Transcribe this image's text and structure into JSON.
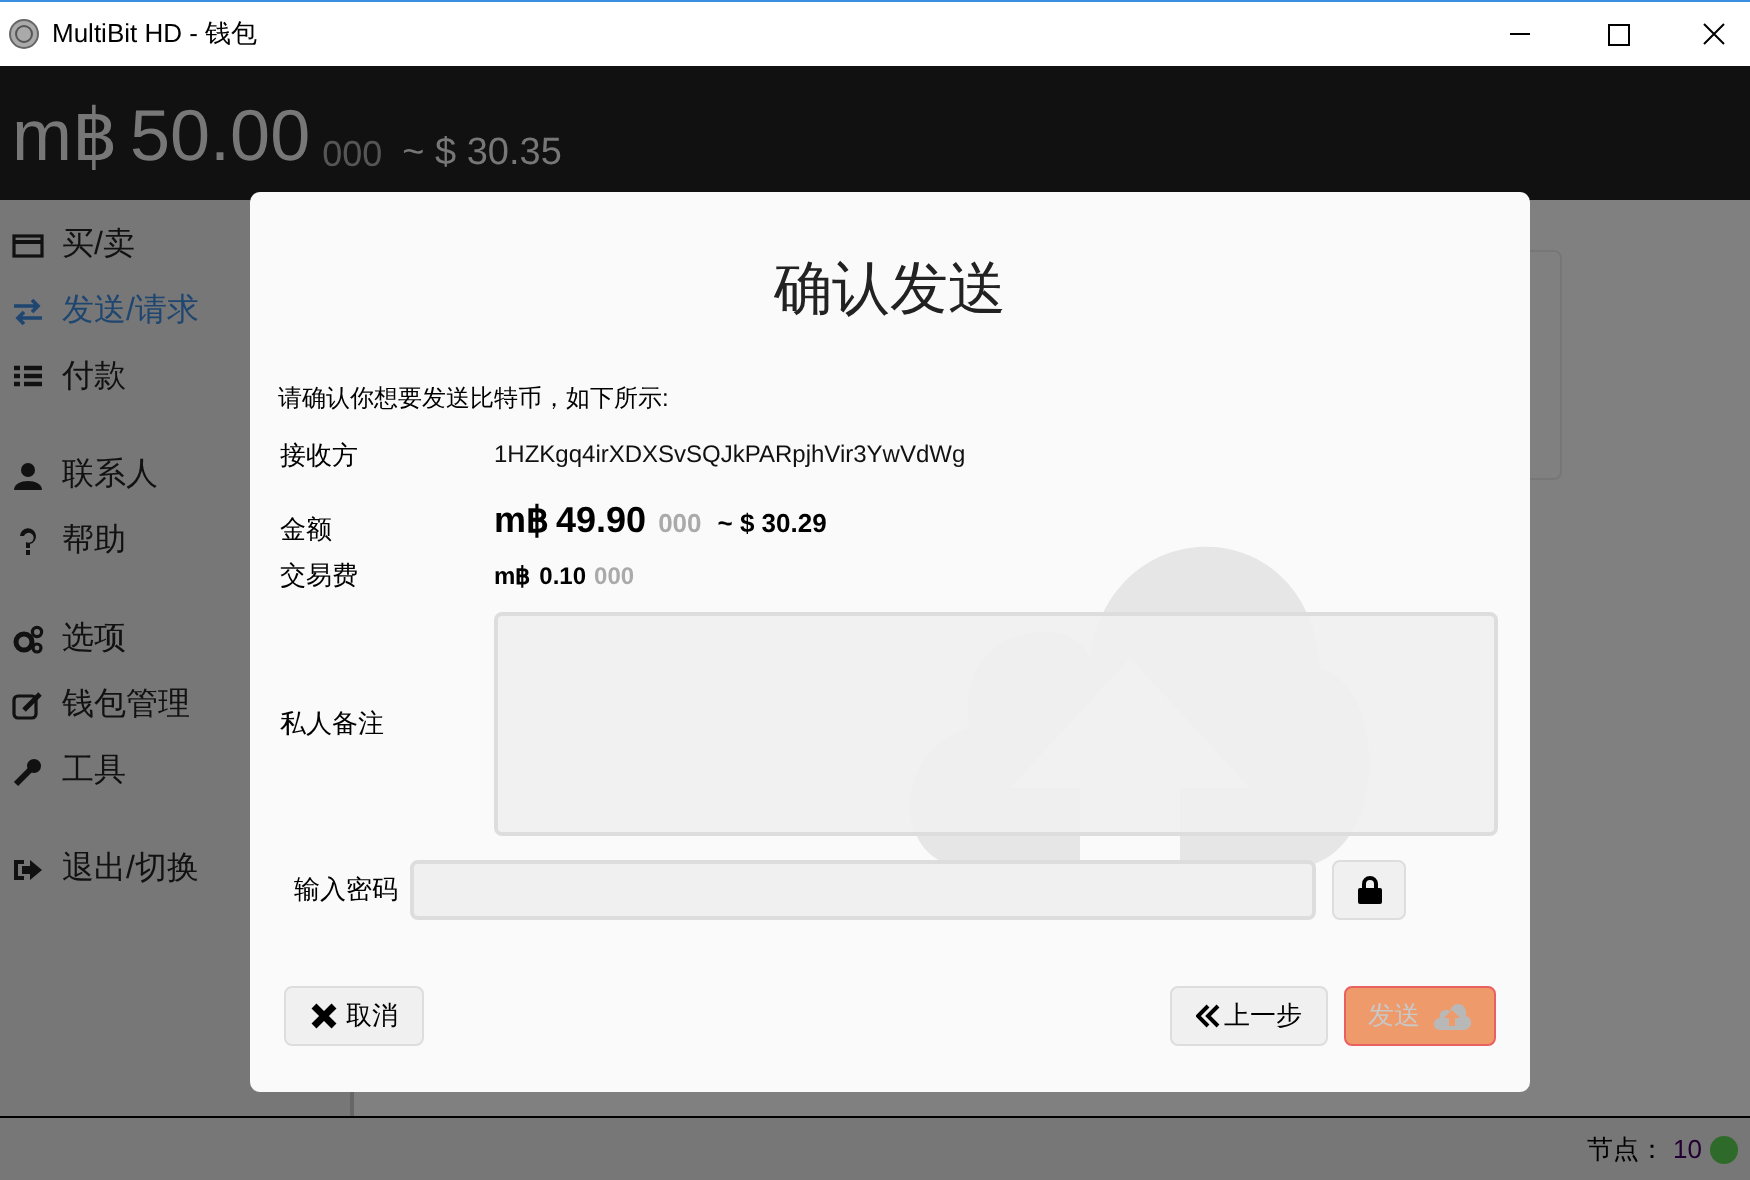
{
  "window": {
    "title": "MultiBit HD - 钱包"
  },
  "header": {
    "symbol": "m฿",
    "amount": "50.00",
    "fraction": "000",
    "fiat": "~ $ 30.35"
  },
  "sidebar": {
    "groups": [
      {
        "items": [
          {
            "label": "买/卖",
            "selected": false
          },
          {
            "label": "发送/请求",
            "selected": true
          },
          {
            "label": "付款",
            "selected": false
          }
        ]
      },
      {
        "items": [
          {
            "label": "联系人",
            "selected": false
          },
          {
            "label": "帮助",
            "selected": false
          }
        ]
      },
      {
        "items": [
          {
            "label": "选项",
            "selected": false
          },
          {
            "label": "钱包管理",
            "selected": false
          },
          {
            "label": "工具",
            "selected": false
          }
        ]
      },
      {
        "items": [
          {
            "label": "退出/切换",
            "selected": false
          }
        ]
      }
    ]
  },
  "dialog": {
    "title": "确认发送",
    "intro": "请确认你想要发送比特币，如下所示:",
    "recipient": {
      "label": "接收方",
      "value": "1HZKgq4irXDXSvSQJkPARpjhVir3YwVdWg"
    },
    "amount": {
      "label": "金额",
      "symbol": "m฿",
      "amount": "49.90",
      "fraction": "000",
      "fiat": "~ $ 30.29"
    },
    "fee": {
      "label": "交易费",
      "symbol": "m฿",
      "amount": "0.10",
      "fraction": "000"
    },
    "notes": {
      "label": "私人备注"
    },
    "password": {
      "label": "输入密码"
    },
    "cancel": "取消",
    "back": "上一步",
    "send": {
      "label": "发送",
      "disabled": true
    }
  },
  "status_bar": {
    "label": "节点：",
    "value": "10",
    "color": "#2e6b2a"
  }
}
